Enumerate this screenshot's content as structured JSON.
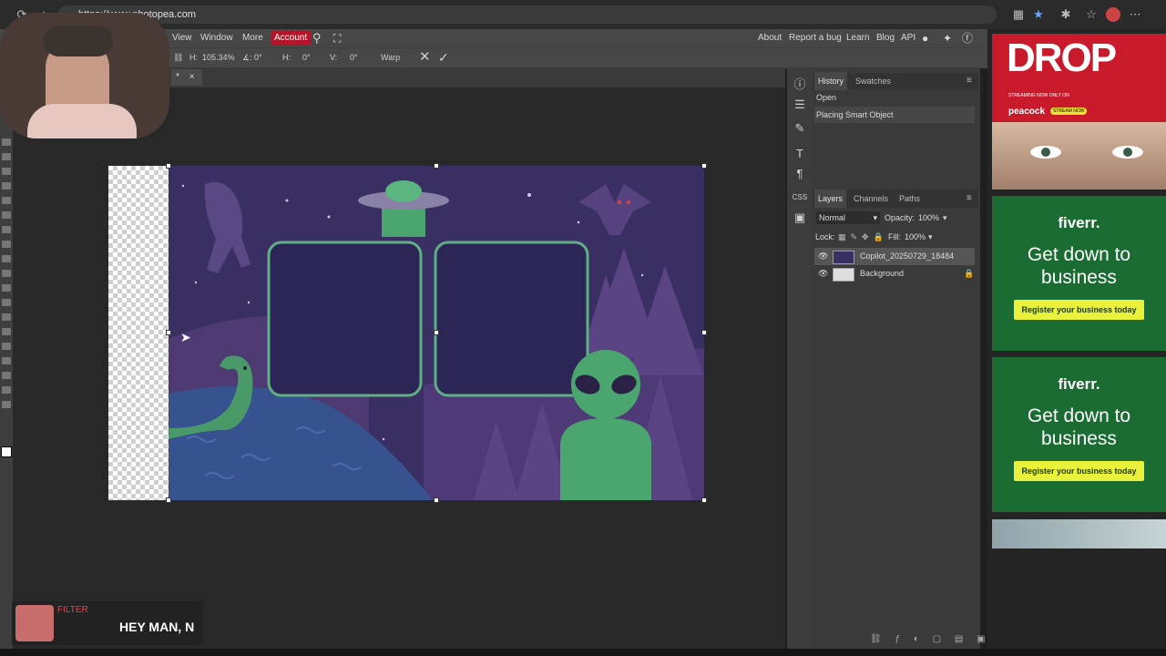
{
  "browser": {
    "url": "https://www.photopea.com",
    "icons": [
      "back-icon",
      "reload-icon",
      "home-icon",
      "star-icon",
      "extensions-icon",
      "profile-icon",
      "menu-icon"
    ]
  },
  "menu": {
    "items": [
      "View",
      "Window",
      "More"
    ],
    "account": "Account",
    "right_links": [
      "About",
      "Report a bug",
      "Learn",
      "Blog",
      "API"
    ]
  },
  "options": {
    "h_label": "H:",
    "h_value": "105.34%",
    "angle_label": "∡:",
    "angle_value": "0°",
    "skew_h_label": "H:",
    "skew_h_value": "0°",
    "skew_v_label": "V:",
    "skew_v_value": "0°",
    "warp": "Warp"
  },
  "doc_tab": {
    "name": "*",
    "close": "×"
  },
  "panels": {
    "history_tabs": [
      "History",
      "Swatches"
    ],
    "history_items": [
      "Open",
      "Placing Smart Object"
    ],
    "layer_tabs": [
      "Layers",
      "Channels",
      "Paths"
    ],
    "blend_mode": "Normal",
    "opacity_label": "Opacity:",
    "opacity_value": "100%",
    "lock_label": "Lock:",
    "fill_label": "Fill:",
    "fill_value": "100%",
    "layers": [
      {
        "name": "Copilot_20250729_18484",
        "selected": true
      },
      {
        "name": "Background",
        "selected": false
      }
    ]
  },
  "side_icons": [
    "info-icon",
    "sliders-icon",
    "brush-icon",
    "text-icon",
    "paragraph-icon",
    "css-icon",
    "image-icon"
  ],
  "ads": {
    "drop_title": "DROP",
    "drop_sub": "STREAMING NOW ONLY ON",
    "drop_brand": "peacock",
    "drop_badge": "STREAM NOW",
    "fiverr_logo": "fiverr.",
    "fiverr_head": "Get down to business",
    "fiverr_button": "Register your business today"
  },
  "overlay": {
    "filter_label": "FILTER",
    "message": "HEY MAN, N"
  },
  "colors": {
    "accent_red": "#b3162b",
    "canvas_bg": "#3a2f63",
    "alien_green": "#4aa56f",
    "fiverr_green": "#1a6c32",
    "fiverr_button": "#e9f13a"
  }
}
